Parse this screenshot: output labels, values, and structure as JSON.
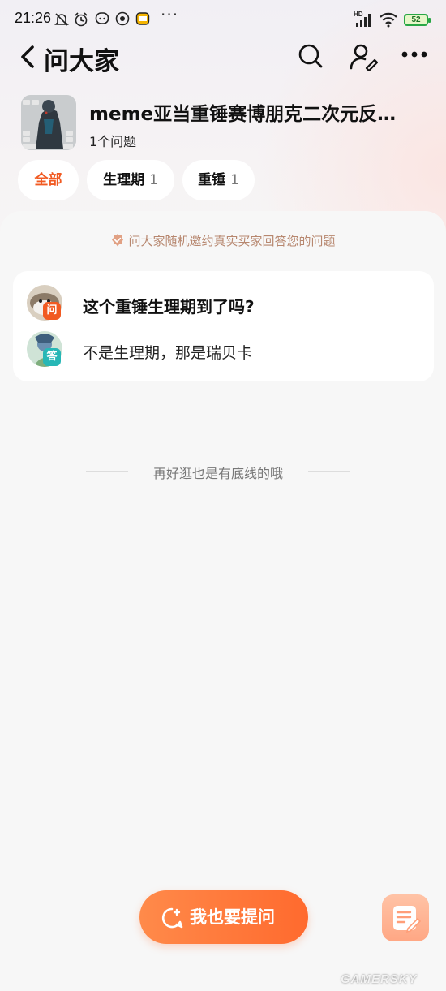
{
  "status_bar": {
    "time": "21:26",
    "dots": "···",
    "network_label": "HD",
    "battery": "52",
    "icons": [
      "bell-muted-icon",
      "alarm-icon",
      "app-icon-1",
      "app-icon-2",
      "app-icon-3",
      "signal-icon",
      "wifi-icon",
      "battery-icon"
    ]
  },
  "nav": {
    "title": "问大家",
    "icons": [
      "back-icon",
      "search-icon",
      "user-edit-icon",
      "more-icon"
    ]
  },
  "topic": {
    "title": "meme亚当重锤赛博朋克二次元反…",
    "count": "1个问题"
  },
  "chips": [
    {
      "label": "全部",
      "count": "",
      "active": true
    },
    {
      "label": "生理期",
      "count": "1",
      "active": false
    },
    {
      "label": "重锤",
      "count": "1",
      "active": false
    }
  ],
  "notice": "问大家随机邀约真实买家回答您的问题",
  "qa": {
    "question_badge": "问",
    "question": "这个重锤生理期到了吗?",
    "answer_badge": "答",
    "answer": "不是生理期，那是瑞贝卡"
  },
  "end_text": "再好逛也是有底线的哦",
  "ask_button": "我也要提问",
  "watermark": "GAMERSKY",
  "colors": {
    "accent": "#f15a22",
    "button": "#ff6a2e",
    "answer_badge": "#27b7b6",
    "notice": "#b7876f"
  }
}
